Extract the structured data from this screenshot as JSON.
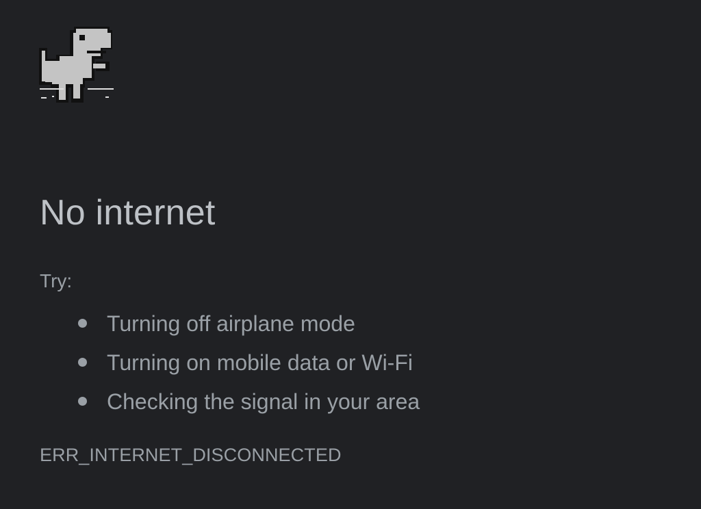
{
  "error_page": {
    "title": "No internet",
    "try_label": "Try:",
    "suggestions": [
      "Turning off airplane mode",
      "Turning on mobile data or Wi-Fi",
      "Checking the signal in your area"
    ],
    "error_code": "ERR_INTERNET_DISCONNECTED"
  },
  "icons": {
    "offline": "dinosaur-icon"
  },
  "colors": {
    "background": "#202124",
    "title": "#bdc1c6",
    "text": "#9aa0a6",
    "dino": "#c4c4c4"
  }
}
